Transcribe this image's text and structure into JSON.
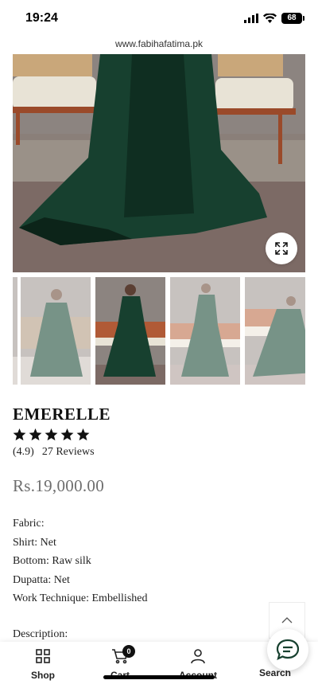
{
  "status": {
    "time": "19:24",
    "battery": "68"
  },
  "browser": {
    "url": "www.fabihafatima.pk"
  },
  "product": {
    "title": "EMERELLE",
    "rating": 5,
    "rating_value": "(4.9)",
    "reviews": "27 Reviews",
    "price": "Rs.19,000.00",
    "specs": [
      "Fabric:",
      "Shirt: Net",
      "Bottom: Raw silk",
      "Dupatta: Net",
      "Work Technique: Embellished"
    ],
    "description_label": "Description:"
  },
  "colors": {
    "emerald": "#17402f",
    "wall": "#8c8480",
    "floor": "#6f5e5a"
  },
  "nav": {
    "shop": "Shop",
    "cart": "Cart",
    "cart_count": "0",
    "account": "Account",
    "search": "Search"
  }
}
